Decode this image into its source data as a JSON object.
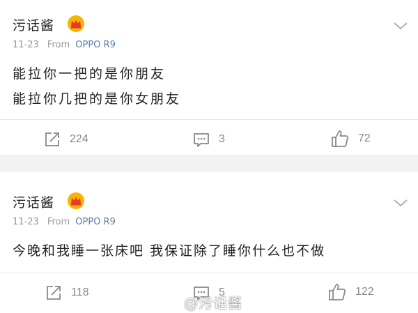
{
  "posts": [
    {
      "user": "污话酱",
      "date": "11-23",
      "from_label": "From",
      "device": "OPPO R9",
      "lines": [
        "能拉你一把的是你朋友",
        "能拉你几把的是你女朋友"
      ],
      "reposts": "224",
      "comments": "3",
      "likes": "72"
    },
    {
      "user": "污话酱",
      "date": "11-23",
      "from_label": "From",
      "device": "OPPO R9",
      "lines": [
        "今晚和我睡一张床吧 我保证除了睡你什么也不做"
      ],
      "reposts": "118",
      "comments": "5",
      "likes": "122"
    }
  ],
  "watermark": "@污话酱",
  "icons": {
    "crown": "crown-badge-icon",
    "menu": "chevron-down-icon",
    "repost": "repost-icon",
    "comment": "comment-icon",
    "like": "thumbs-up-icon"
  },
  "colors": {
    "device_link": "#5a7fa8",
    "crown_gold": "#f5b400",
    "crown_red": "#e8382f"
  }
}
